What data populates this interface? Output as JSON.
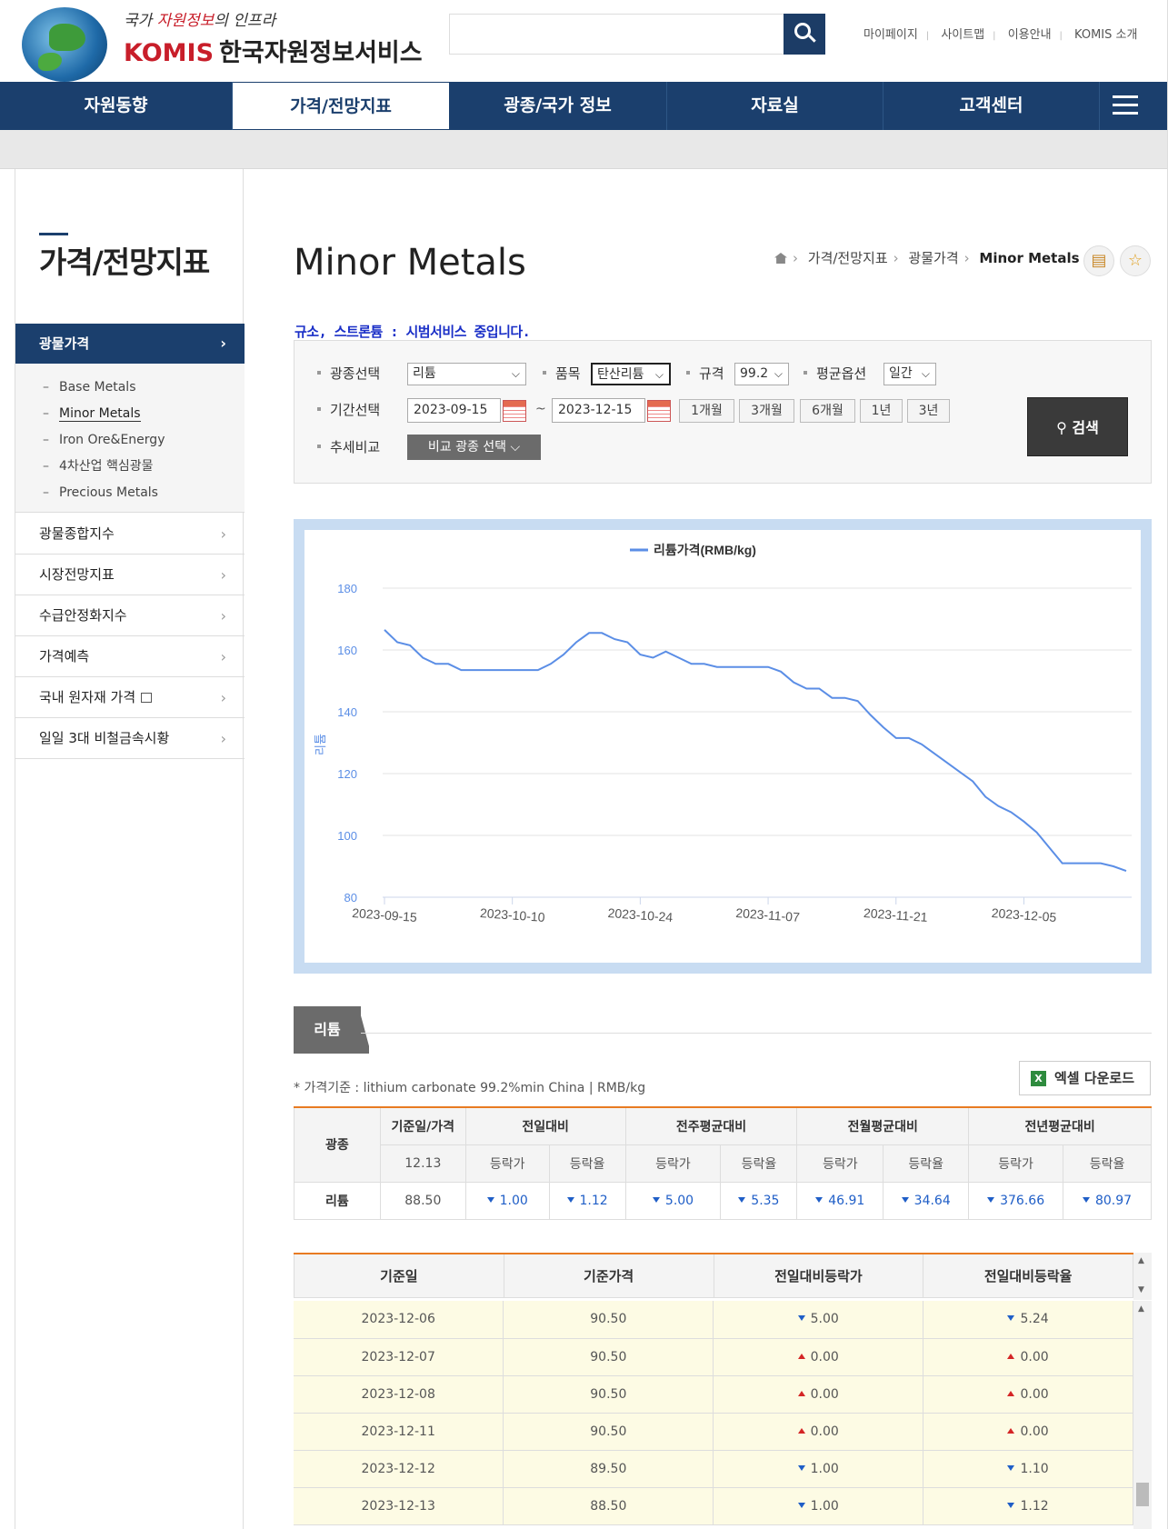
{
  "header": {
    "tagline_1": "국가",
    "tagline_2": "자원정보",
    "tagline_3": "의 인프라",
    "brand": "KOMIS",
    "org_name": "한국자원정보서비스",
    "search_placeholder": "",
    "util_links": [
      "마이페이지",
      "사이트맵",
      "이용안내",
      "KOMIS 소개"
    ]
  },
  "gnb": [
    "자원동향",
    "가격/전망지표",
    "광종/국가 정보",
    "자료실",
    "고객센터"
  ],
  "lnb": {
    "title": "가격/전망지표",
    "active": "광물가격",
    "sub_items": [
      "Base Metals",
      "Minor Metals",
      "Iron Ore&Energy",
      "4차산업 핵심광물",
      "Precious Metals"
    ],
    "items": [
      "광물종합지수",
      "시장전망지표",
      "수급안정화지수",
      "가격예측",
      "국내 원자재 가격",
      "일일 3대 비철금속시황"
    ]
  },
  "page": {
    "title": "Minor Metals",
    "breadcrumb": [
      "가격/전망지표",
      "광물가격",
      "Minor Metals"
    ],
    "notice": "규소, 스트론튬 : 시범서비스 중입니다."
  },
  "filters": {
    "mineral_label": "광종선택",
    "mineral_value": "리튬",
    "item_label": "품목",
    "item_value": "탄산리튬",
    "spec_label": "규격",
    "spec_value": "99.2",
    "avg_label": "평균옵션",
    "avg_value": "일간",
    "period_label": "기간선택",
    "date_from": "2023-09-15",
    "date_tilde": "~",
    "date_to": "2023-12-15",
    "periods": [
      "1개월",
      "3개월",
      "6개월",
      "1년",
      "3년"
    ],
    "trend_label": "추세비교",
    "compare_btn": "비교 광종 선택",
    "search_btn": "검색"
  },
  "chart_data": {
    "type": "line",
    "legend": "리튬가격(RMB/kg)",
    "ylabel": "리튬",
    "ylim": [
      80,
      180
    ],
    "yticks": [
      80,
      100,
      120,
      140,
      160,
      180
    ],
    "xtick_labels": [
      "2023-09-15",
      "2023-10-10",
      "2023-10-24",
      "2023-11-07",
      "2023-11-21",
      "2023-12-05"
    ],
    "grid": true,
    "legend_position": "top",
    "color": "#5b8ee6",
    "series": [
      {
        "name": "리튬가격(RMB/kg)",
        "values": [
          166.5,
          162.5,
          161.5,
          157.5,
          155.5,
          155.5,
          153.5,
          153.5,
          153.5,
          153.5,
          153.5,
          153.5,
          153.5,
          155.5,
          158.5,
          162.5,
          165.5,
          165.5,
          163.5,
          162.5,
          158.5,
          157.5,
          159.5,
          157.5,
          155.5,
          155.5,
          154.5,
          154.5,
          154.5,
          154.5,
          154.5,
          153.0,
          149.5,
          147.5,
          147.5,
          144.5,
          144.5,
          143.5,
          139.0,
          135.0,
          131.5,
          131.5,
          129.5,
          126.5,
          123.5,
          120.5,
          117.5,
          112.5,
          109.5,
          107.5,
          104.5,
          101.0,
          96.0,
          91.0,
          91.0,
          91.0,
          91.0,
          90.0,
          88.5
        ]
      }
    ]
  },
  "tab": "리튬",
  "excel_btn": "엑셀 다운로드",
  "price_note": "* 가격기준 : lithium carbonate 99.2%min China  |  RMB/kg",
  "summary": {
    "h_mineral": "광종",
    "h_date": "기준일/가격",
    "h_day": "전일대비",
    "h_week": "전주평균대비",
    "h_month": "전월평균대비",
    "h_year": "전년평균대비",
    "date": "12.13",
    "sub_amt": "등락가",
    "sub_rate": "등락율",
    "row_name": "리튬",
    "price": "88.50",
    "day_amt": "1.00",
    "day_rate": "1.12",
    "week_amt": "5.00",
    "week_rate": "5.35",
    "month_amt": "46.91",
    "month_rate": "34.64",
    "year_amt": "376.66",
    "year_rate": "80.97"
  },
  "history": {
    "headers": [
      "기준일",
      "기준가격",
      "전일대비등락가",
      "전일대비등락율"
    ],
    "rows": [
      {
        "date": "2023-12-06",
        "price": "90.50",
        "amt": "5.00",
        "rate": "5.24",
        "dir": "down"
      },
      {
        "date": "2023-12-07",
        "price": "90.50",
        "amt": "0.00",
        "rate": "0.00",
        "dir": "up"
      },
      {
        "date": "2023-12-08",
        "price": "90.50",
        "amt": "0.00",
        "rate": "0.00",
        "dir": "up"
      },
      {
        "date": "2023-12-11",
        "price": "90.50",
        "amt": "0.00",
        "rate": "0.00",
        "dir": "up"
      },
      {
        "date": "2023-12-12",
        "price": "89.50",
        "amt": "1.00",
        "rate": "1.10",
        "dir": "down"
      },
      {
        "date": "2023-12-13",
        "price": "88.50",
        "amt": "1.00",
        "rate": "1.12",
        "dir": "down"
      }
    ]
  }
}
